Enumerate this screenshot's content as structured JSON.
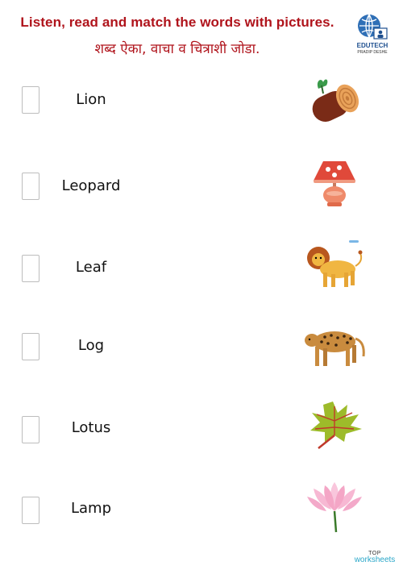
{
  "header": {
    "title": "Listen, read and match the words with pictures.",
    "subtitle": "शब्द ऐका, वाचा व चित्राशी जोडा."
  },
  "logo": {
    "name": "EDUTECH",
    "sub": "PRADIP DESHE"
  },
  "words": [
    "Lion",
    "Leopard",
    "Leaf",
    "Log",
    "Lotus",
    "Lamp"
  ],
  "pictures": [
    "log-icon",
    "lamp-icon",
    "lion-icon",
    "leopard-icon",
    "leaf-icon",
    "lotus-icon"
  ],
  "footer": {
    "top": "TOP",
    "brand": "worksheets"
  }
}
